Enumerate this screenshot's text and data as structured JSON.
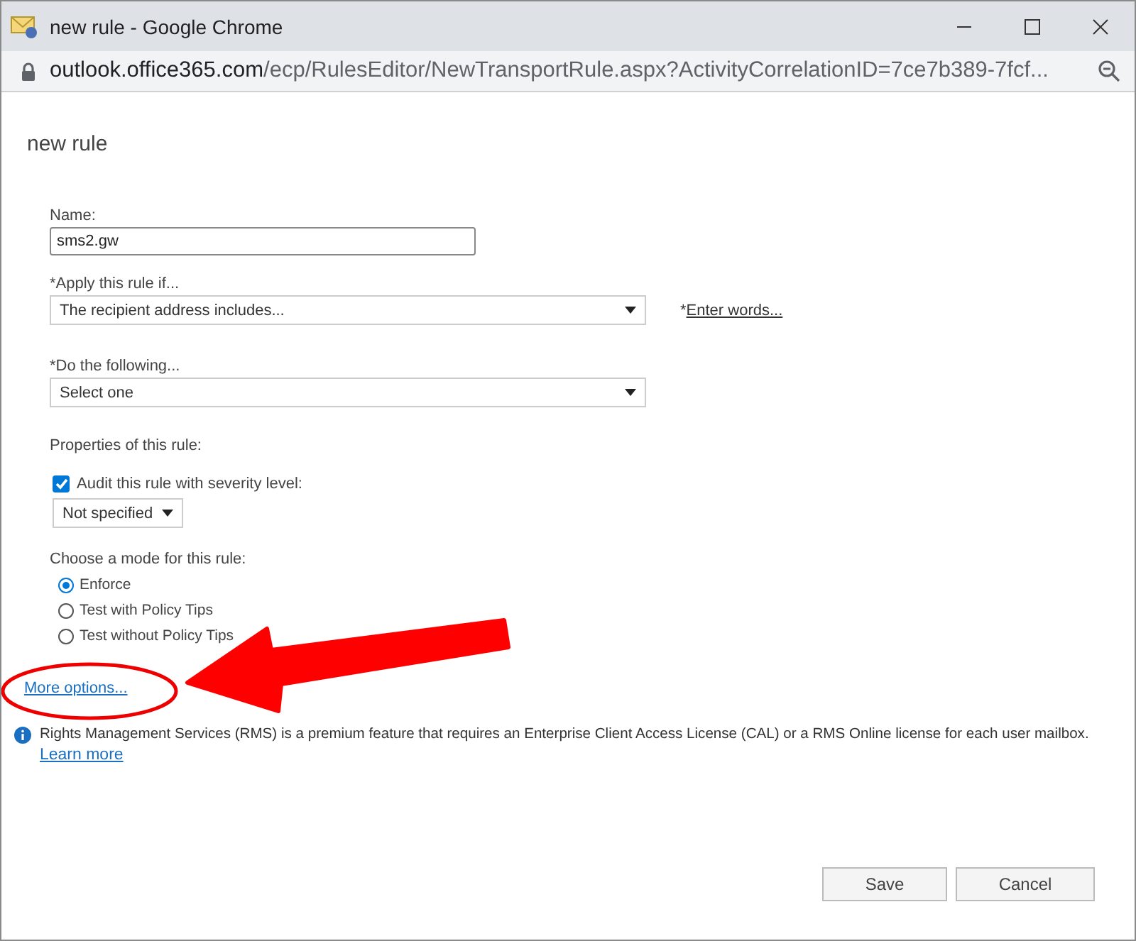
{
  "window": {
    "title": "new rule - Google Chrome"
  },
  "address_bar": {
    "host": "outlook.office365.com",
    "path": "/ecp/RulesEditor/NewTransportRule.aspx?ActivityCorrelationID=7ce7b389-7fcf..."
  },
  "page_title": "new rule",
  "name_field": {
    "label": "Name:",
    "value": "sms2.gw"
  },
  "condition": {
    "label": "*Apply this rule if...",
    "value": "The recipient address includes...",
    "link_prefix": "*",
    "link": "Enter words..."
  },
  "action": {
    "label": "*Do the following...",
    "value": "Select one"
  },
  "properties": {
    "label": "Properties of this rule:",
    "audit": {
      "label": "Audit this rule with severity level:",
      "checked": true
    },
    "severity": "Not specified"
  },
  "mode": {
    "label": "Choose a mode for this rule:",
    "options": [
      {
        "label": "Enforce",
        "selected": true
      },
      {
        "label": "Test with Policy Tips",
        "selected": false
      },
      {
        "label": "Test without Policy Tips",
        "selected": false
      }
    ]
  },
  "more_options": "More options...",
  "info": {
    "text": "Rights Management Services (RMS) is a premium feature that requires an Enterprise Client Access License (CAL) or a RMS Online license for each user mailbox.",
    "link": "Learn more"
  },
  "buttons": [
    "Save",
    "Cancel"
  ]
}
